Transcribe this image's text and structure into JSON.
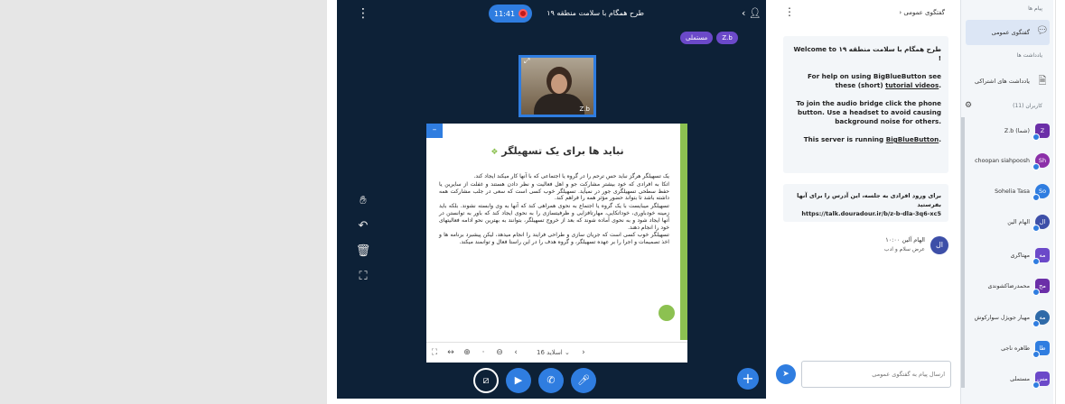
{
  "main": {
    "presentation_title": "طرح همگام با سلامت منطقه ۱۹",
    "recording_time": "11:41",
    "talkers": [
      {
        "label": "Z.b"
      },
      {
        "label": "مستملی"
      }
    ],
    "webcam_name": "Z.b",
    "slide": {
      "title": "نباید ها برای یک تسهیلگر",
      "paragraphs": [
        "یک تسهیلگر هرگز نباید حس ترحم را در گروه یا اجتماعی که با آنها کار میکند ایجاد کند.",
        "اتکا به افرادی که خود بیشتر مشارکت جو و اهل فعالیت و نظر دادن هستند و غفلت از سایرین یا حفظ سطحی تسهیلگری جور در نمیآید. تسهیلگر خوب کسی است که سعی در جلب مشارکت همه داشته باشد تا بتواند حضور مؤثر همه را فراهم کند.",
        "تسهیلگر میبایست با یک گروه یا اجتماع به نحوی همراهی کند که آنها به وی وابسته نشوند. بلکه باید زمینه خودباوری، خوداتکایی، مهارتافزایی و ظرفیتسازی را به نحوی ایجاد کند که باور به توانستن در آنها ایجاد شود و به نحوی آماده شوند که بعد از خروج تسهیلگر، بتوانند به بهترین نحو ادامه فعالیتهای خود را انجام دهند.",
        "تسهیلگر خوب کسی است که جریان سازی و طراحی فرایند را انجام میدهد، لیکن پیشبرد برنامه ها و اخذ تصمیمات و اجرا را بر عهده تسهیلگر، و گروه هدف را در این راستا فعال و توانمند میکند."
      ],
      "page_label": "اسلاید 16"
    }
  },
  "chat": {
    "title": "گفتگوی عمومی",
    "welcome_line1": "Welcome to طرح همگام با سلامت منطقه ۱۹ !",
    "help_text": "For help on using BigBlueButton see these (short)",
    "help_link": "tutorial videos",
    "audio_text": "To join the audio bridge click the phone button. Use a headset to avoid causing background noise for others.",
    "running_text": "This server is running",
    "running_link": "BigBlueButton",
    "invite_line1": "برای ورود افرادی به جلسه، این آدرس را برای آنها بفرستید",
    "invite_line2": "https://talk.douradour.ir/b/z-b-dla-3q6-xc5",
    "message": {
      "avatar": "ال",
      "name": "الهام آلین",
      "time": "۱۰:۰۰",
      "text": "عرض سلام و ادب"
    },
    "input_placeholder": "ارسال پیام به گفتگوی عمومی"
  },
  "users": {
    "section_messages_label": "پیام ها",
    "public_chat_label": "گفتگوی عمومی",
    "section_notes_label": "یادداشت ها",
    "shared_notes_label": "یادداشت های اشتراکی",
    "section_users_label": "کاربران (11)",
    "list": [
      {
        "initials": "Z",
        "name": "Z.b (شما)",
        "color": "#6b2fa8"
      },
      {
        "initials": "Sh",
        "name": "choopan siahpoosh",
        "color": "#8b2fa8"
      },
      {
        "initials": "So",
        "name": "Sohelia Tasa",
        "color": "#2f7de0"
      },
      {
        "initials": "ال",
        "name": "الهام آلین",
        "color": "#3d4fa8"
      },
      {
        "initials": "مه",
        "name": "مهتاگری",
        "color": "#6b49c9"
      },
      {
        "initials": "مح",
        "name": "محمدرضاکشوندی",
        "color": "#6b2fa8"
      },
      {
        "initials": "مه",
        "name": "مهیار جویژل سوارکوش",
        "color": "#2f6aa8"
      },
      {
        "initials": "طا",
        "name": "طاهره ناجی",
        "color": "#2f7de0"
      },
      {
        "initials": "مس",
        "name": "مستملی",
        "color": "#6b49c9"
      }
    ]
  }
}
